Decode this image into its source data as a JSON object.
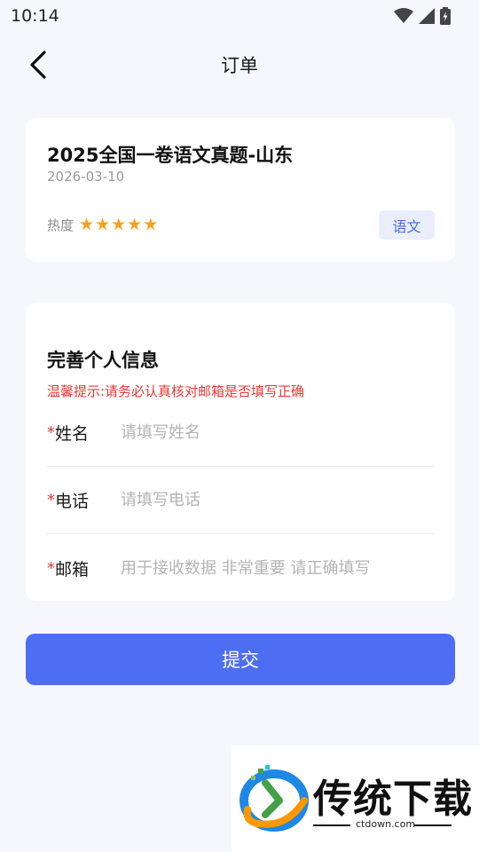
{
  "status_bar": {
    "time": "10:14"
  },
  "nav": {
    "title": "订单"
  },
  "product": {
    "title": "2025全国一卷语文真题-山东",
    "date": "2026-03-10",
    "hot_label": "热度",
    "rating": 5,
    "subject_tag": "语文"
  },
  "form": {
    "title": "完善个人信息",
    "tip": "温馨提示:请务必认真核对邮箱是否填写正确",
    "required_mark": "*",
    "fields": [
      {
        "label": "姓名",
        "placeholder": "请填写姓名",
        "value": ""
      },
      {
        "label": "电话",
        "placeholder": "请填写电话",
        "value": ""
      },
      {
        "label": "邮箱",
        "placeholder": "用于接收数据 非常重要 请正确填写",
        "value": ""
      }
    ]
  },
  "submit_label": "提交",
  "watermark": {
    "brand": "传统下载",
    "domain": "ctdown.com"
  },
  "colors": {
    "accent": "#4d6ef3",
    "star": "#f7a21b",
    "warning": "#e53935",
    "tag_bg": "#eaeefc"
  }
}
